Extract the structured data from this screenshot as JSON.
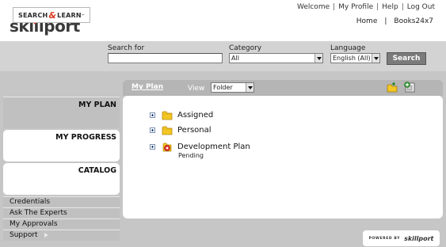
{
  "brand": {
    "logo_text": "skillport",
    "logo_tm": "™",
    "search_learn_left": "SEARCH",
    "search_learn_amp": "&",
    "search_learn_right": "LEARN",
    "search_learn_tm": "™"
  },
  "top_links": {
    "welcome": "Welcome",
    "my_profile": "My Profile",
    "help": "Help",
    "log_out": "Log Out",
    "separator": "|"
  },
  "sub_links": {
    "home": "Home",
    "books": "Books24x7",
    "separator": "|"
  },
  "search": {
    "search_for_label": "Search for",
    "search_for_value": "",
    "category_label": "Category",
    "category_value": "All",
    "language_label": "Language",
    "language_value": "English (All)",
    "search_button": "Search"
  },
  "nav": {
    "my_plan": "MY PLAN",
    "my_progress": "MY PROGRESS",
    "catalog": "CATALOG",
    "links": [
      {
        "label": "Credentials"
      },
      {
        "label": "Ask The Experts"
      },
      {
        "label": "My Approvals"
      },
      {
        "label": "Support"
      }
    ]
  },
  "panel": {
    "title": "My Plan",
    "view_label": "View",
    "view_value": "Folder",
    "tree": [
      {
        "label": "Assigned",
        "icon": "folder-icon"
      },
      {
        "label": "Personal",
        "icon": "folder-icon"
      },
      {
        "label": "Development Plan",
        "icon": "development-plan-icon",
        "sub": "Pending"
      }
    ]
  },
  "footer": {
    "powered_by": "POWERED BY",
    "powered_logo": "skillport"
  },
  "colors": {
    "header_bg": "#ffffff",
    "bar_gray": "#d3d3d3",
    "body_gray": "#c6c6c6",
    "panel_head": "#b5b5b5",
    "search_button": "#7b7b7b",
    "accent_red": "#d9381e",
    "folder_yellow": "#f3c623"
  }
}
